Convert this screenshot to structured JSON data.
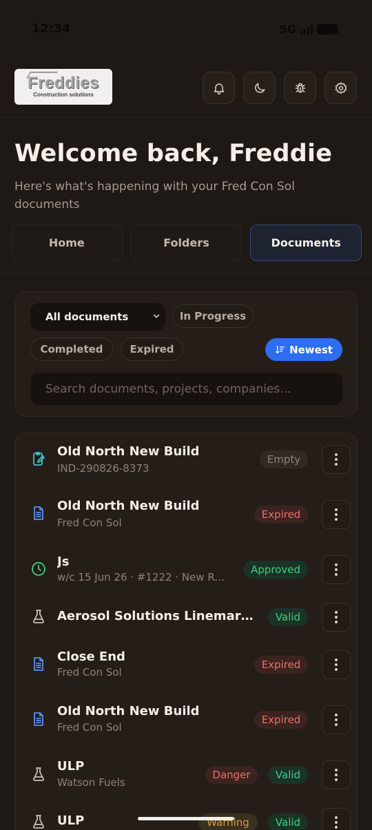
{
  "status_bar": {
    "time": "12:34",
    "network": "5G"
  },
  "logo": {
    "name": "Freddies",
    "tagline": "Construction solutions"
  },
  "header_icons": [
    "bell-icon",
    "moon-icon",
    "bug-icon",
    "gear-icon"
  ],
  "welcome": {
    "title": "Welcome back, Freddie",
    "subtitle": "Here's what's happening with your Fred Con Sol documents"
  },
  "tabs": [
    {
      "label": "Home",
      "active": false
    },
    {
      "label": "Folders",
      "active": false
    },
    {
      "label": "Documents",
      "active": true
    }
  ],
  "filters": {
    "select_value": "All documents",
    "chips": [
      "In Progress",
      "Completed",
      "Expired"
    ],
    "sort_label": "Newest",
    "search_placeholder": "Search documents, projects, companies..."
  },
  "documents": [
    {
      "icon": "clipboard-edit-icon",
      "icon_color": "#3fc3c9",
      "title": "Old North New Build",
      "subtitle": "IND-290826-8373",
      "badges": [
        {
          "label": "Empty",
          "kind": "empty"
        }
      ]
    },
    {
      "icon": "document-icon",
      "icon_color": "#5b8ff0",
      "title": "Old North New Build",
      "subtitle": "Fred Con Sol",
      "badges": [
        {
          "label": "Expired",
          "kind": "expired"
        }
      ]
    },
    {
      "icon": "clock-icon",
      "icon_color": "#3ecf7e",
      "title": "Js",
      "subtitle": "w/c 15 Jun 26 · #1222 · New Rock ...",
      "badges": [
        {
          "label": "Approved",
          "kind": "approved"
        }
      ]
    },
    {
      "icon": "flask-icon",
      "icon_color": "#c8c0b8",
      "title": "Aerosol Solutions Linemarker (...",
      "subtitle": "",
      "badges": [
        {
          "label": "Valid",
          "kind": "valid"
        }
      ]
    },
    {
      "icon": "document-icon",
      "icon_color": "#5b8ff0",
      "title": "Close End",
      "subtitle": "Fred Con Sol",
      "badges": [
        {
          "label": "Expired",
          "kind": "expired"
        }
      ]
    },
    {
      "icon": "document-icon",
      "icon_color": "#5b8ff0",
      "title": "Old North New Build",
      "subtitle": "Fred Con Sol",
      "badges": [
        {
          "label": "Expired",
          "kind": "expired"
        }
      ]
    },
    {
      "icon": "flask-icon",
      "icon_color": "#c8c0b8",
      "title": "ULP",
      "subtitle": "Watson Fuels",
      "badges": [
        {
          "label": "Danger",
          "kind": "danger"
        },
        {
          "label": "Valid",
          "kind": "valid"
        }
      ]
    },
    {
      "icon": "flask-icon",
      "icon_color": "#c8c0b8",
      "title": "ULP",
      "subtitle": "",
      "badges": [
        {
          "label": "Warning",
          "kind": "warning"
        },
        {
          "label": "Valid",
          "kind": "valid"
        }
      ]
    }
  ]
}
